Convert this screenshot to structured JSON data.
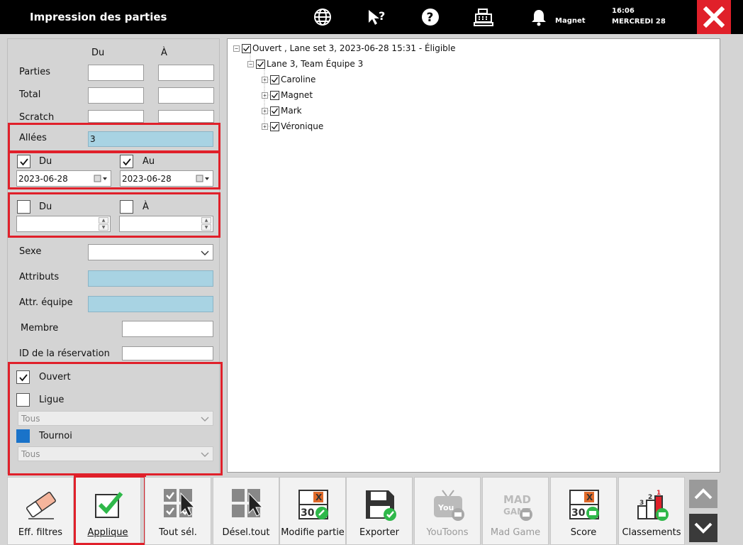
{
  "window": {
    "title": "Impression des parties",
    "user": "Magnet",
    "time": "16:06",
    "day": "MERCREDI 28"
  },
  "filters": {
    "col_from": "Du",
    "col_to": "À",
    "parties_label": "Parties",
    "total_label": "Total",
    "scratch_label": "Scratch",
    "allees_label": "Allées",
    "allees_value": "3",
    "date_from_label": "Du",
    "date_to_label": "Au",
    "date_from_value": "2023-06-28",
    "date_to_value": "2023-06-28",
    "num_from_label": "Du",
    "num_to_label": "À",
    "sexe_label": "Sexe",
    "attributs_label": "Attributs",
    "attr_equipe_label": "Attr. équipe",
    "membre_label": "Membre",
    "reservation_label": "ID de la réservation",
    "ouvert_label": "Ouvert",
    "ligue_label": "Ligue",
    "ligue_select": "Tous",
    "tournoi_label": "Tournoi",
    "tournoi_select": "Tous"
  },
  "tree": {
    "root": "Ouvert , Lane set 3, 2023-06-28 15:31  - Éligible",
    "team": "Lane 3, Team Équipe 3",
    "players": [
      "Caroline",
      "Magnet",
      "Mark",
      "Véronique"
    ]
  },
  "toolbar": {
    "buttons": [
      {
        "label": "Eff. filtres"
      },
      {
        "label": "Applique"
      },
      {
        "label": "Tout sél."
      },
      {
        "label": "Désel.tout"
      },
      {
        "label": "Modifie partie"
      },
      {
        "label": "Exporter"
      },
      {
        "label": "YouToons"
      },
      {
        "label": "Mad Game"
      },
      {
        "label": "Score"
      },
      {
        "label": "Classements"
      }
    ]
  },
  "colors": {
    "accent_red": "#e0202a",
    "field_blue": "#a8d3e3",
    "check_green": "#2fb84a"
  }
}
